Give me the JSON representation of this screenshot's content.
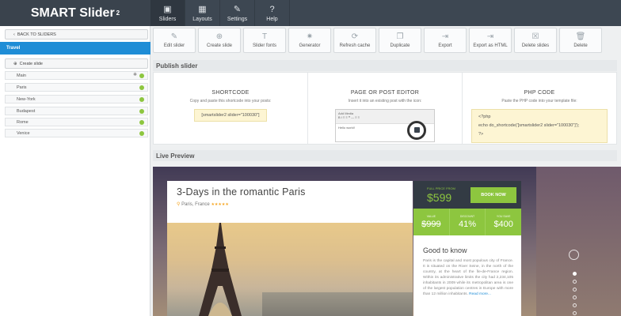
{
  "app": {
    "logo": "SMART Slider",
    "logo_version": "2"
  },
  "topnav": [
    {
      "label": "Sliders",
      "icon": "image-icon",
      "glyph": "▣"
    },
    {
      "label": "Layouts",
      "icon": "grid-icon",
      "glyph": "▦"
    },
    {
      "label": "Settings",
      "icon": "wrench-icon",
      "glyph": "✎"
    },
    {
      "label": "Help",
      "icon": "help-icon",
      "glyph": "?"
    }
  ],
  "sidebar": {
    "back_label": "BACK TO SLIDERS",
    "slider_name": "Travel",
    "create_label": "Create slide",
    "slides": [
      "Main",
      "Paris",
      "New-York",
      "Budapest",
      "Rome",
      "Venice"
    ]
  },
  "toolbar": [
    {
      "label": "Edit slider",
      "icon": "edit-icon",
      "glyph": "✎"
    },
    {
      "label": "Create slide",
      "icon": "plus-circle-icon",
      "glyph": "⊕"
    },
    {
      "label": "Slider fonts",
      "icon": "font-icon",
      "glyph": "T"
    },
    {
      "label": "Generator",
      "icon": "gear-icon",
      "glyph": "✷"
    },
    {
      "label": "Refresh cache",
      "icon": "refresh-icon",
      "glyph": "⟳"
    },
    {
      "label": "Duplicate",
      "icon": "duplicate-icon",
      "glyph": "❐"
    },
    {
      "label": "Export",
      "icon": "export-icon",
      "glyph": "⇥"
    },
    {
      "label": "Export as HTML",
      "icon": "export-html-icon",
      "glyph": "⇥"
    },
    {
      "label": "Delete slides",
      "icon": "delete-slides-icon",
      "glyph": "☒"
    },
    {
      "label": "Delete",
      "icon": "trash-icon",
      "glyph": "🗑"
    }
  ],
  "publish": {
    "title": "Publish slider",
    "shortcode": {
      "heading": "SHORTCODE",
      "desc": "Copy and paste this shortcode into your posts:",
      "code": "[smartslider2 slider=\"100030\"]"
    },
    "editor": {
      "heading": "PAGE OR POST EDITOR",
      "desc": "Insert it into an existing post with the icon:",
      "mock_text": "Hello world!",
      "mock_button": "Add Media"
    },
    "php": {
      "heading": "PHP CODE",
      "desc": "Paste the PHP code into your template file:",
      "line1": "<?php",
      "line2": "echo do_shortcode('[smartslider2 slider=\"100030\"]');",
      "line3": "?>"
    }
  },
  "preview": {
    "title": "Live Preview",
    "card_title": "3-Days in the romantic Paris",
    "location": "Paris, France",
    "stars": "★★★★★",
    "full_price_label": "FULL PRICE FROM",
    "price": "$599",
    "book_label": "BOOK NOW",
    "stats": [
      {
        "label": "VALUE",
        "value": "$999",
        "strike": true
      },
      {
        "label": "DISCOUNT",
        "value": "41%"
      },
      {
        "label": "YOU SAVE",
        "value": "$400"
      }
    ],
    "info_title": "Good to know",
    "info_text": "Paris is the capital and most populous city of France. It is situated on the River Seine, in the north of the country, at the heart of the Île-de-France region. Within its administrative limits the city had 2,234,105 inhabitants in 2009 while its metropolitan area is one of the largest population centres in Europe with more than 12 million inhabitants.",
    "read_more": "Read more..."
  },
  "colors": {
    "accent": "#1f8dd6",
    "green": "#8dc63f",
    "dark": "#333b44"
  }
}
